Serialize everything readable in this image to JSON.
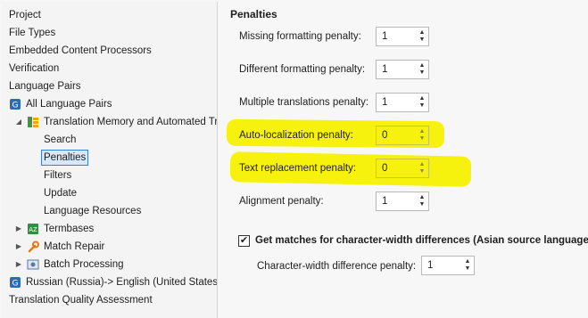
{
  "tree": {
    "project": "Project",
    "file_types": "File Types",
    "embedded": "Embedded Content Processors",
    "verification": "Verification",
    "language_pairs": "Language Pairs",
    "all_language_pairs": "All Language Pairs",
    "tm_automated": "Translation Memory and Automated Tr",
    "search": "Search",
    "penalties": "Penalties",
    "filters": "Filters",
    "update": "Update",
    "language_resources": "Language Resources",
    "termbases": "Termbases",
    "match_repair": "Match Repair",
    "batch_processing": "Batch Processing",
    "russian_english": "Russian (Russia)-> English (United States)",
    "tqa": "Translation Quality Assessment"
  },
  "penalties": {
    "title": "Penalties",
    "missing_formatting": {
      "label": "Missing formatting penalty:",
      "value": "1"
    },
    "different_formatting": {
      "label": "Different formatting penalty:",
      "value": "1"
    },
    "multiple_translations": {
      "label": "Multiple translations penalty:",
      "value": "1"
    },
    "auto_localization": {
      "label": "Auto-localization penalty:",
      "value": "0"
    },
    "text_replacement": {
      "label": "Text replacement penalty:",
      "value": "0"
    },
    "alignment": {
      "label": "Alignment penalty:",
      "value": "1"
    },
    "char_width_checkbox": {
      "label": "Get matches for character-width differences (Asian source languages)",
      "checked": true
    },
    "char_width_penalty": {
      "label": "Character-width difference penalty:",
      "value": "1"
    }
  },
  "colors": {
    "highlight": "#f7f100",
    "selection_border": "#3b7fd1",
    "selection_bg": "#d8e8fb"
  }
}
